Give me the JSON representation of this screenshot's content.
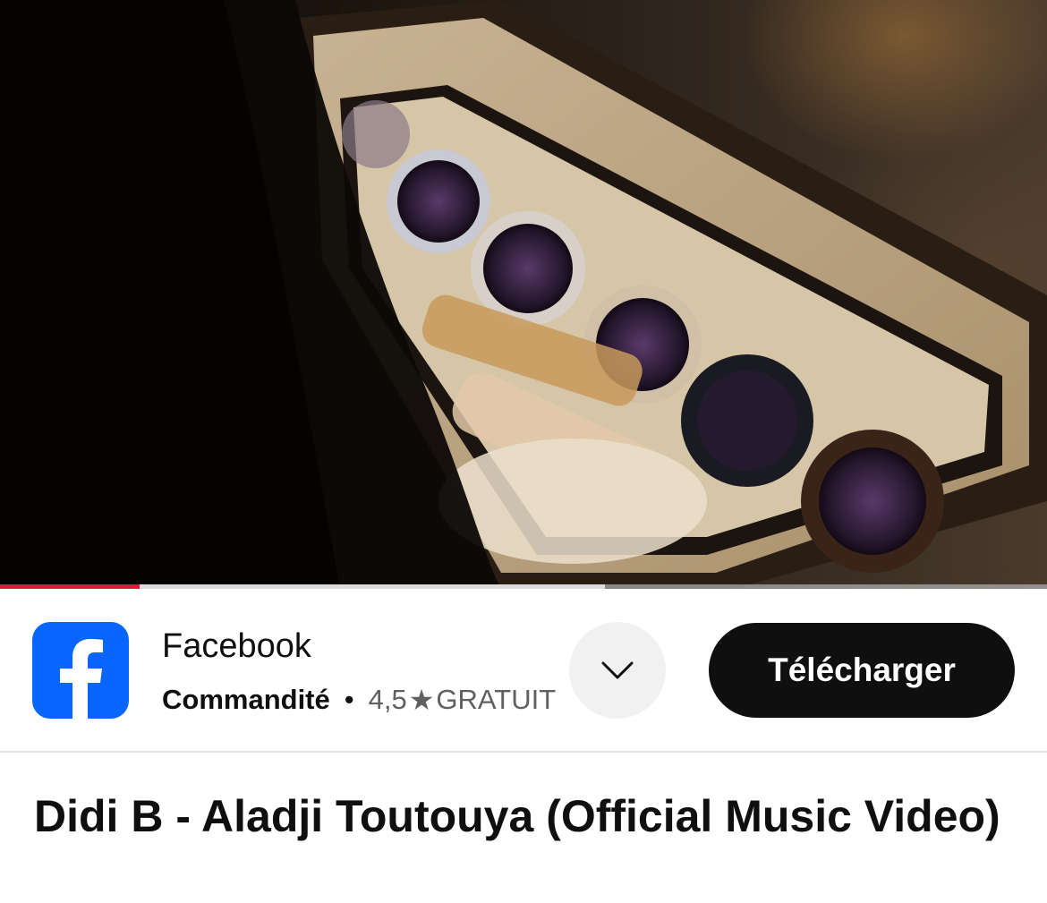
{
  "video": {
    "progress": 0.133,
    "buffered": 0.578,
    "accent_color": "#e8173a"
  },
  "ad": {
    "advertiser": "Facebook",
    "sponsored_label": "Commandité",
    "separator": "•",
    "rating": "4,5",
    "price": "GRATUIT",
    "cta_label": "Télécharger",
    "logo_icon": "facebook-logo-icon",
    "expand_icon": "chevron-down-icon",
    "brand_color": "#0866ff"
  },
  "video_title": "Didi B - Aladji Toutouya (Official Music Video)"
}
